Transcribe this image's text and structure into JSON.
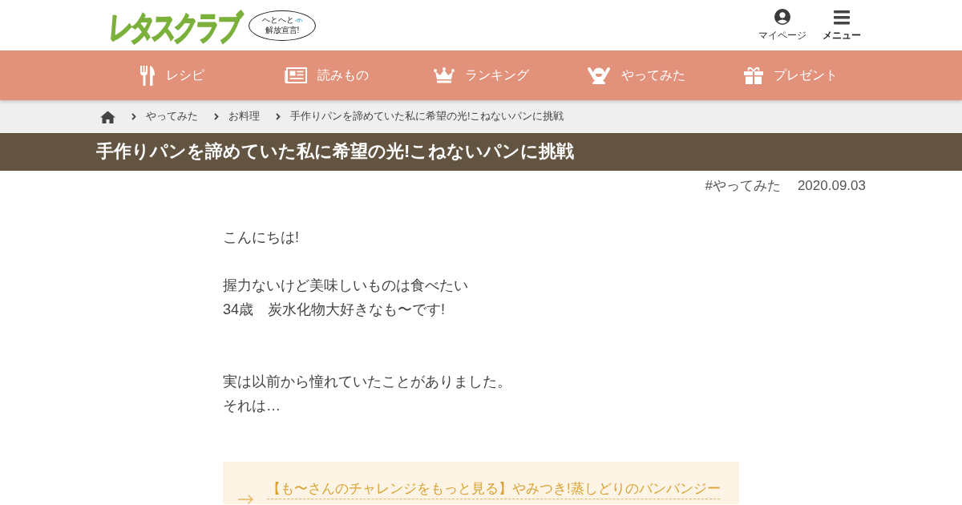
{
  "header": {
    "logo": "レタスクラブ",
    "tagline": [
      "へとへと",
      "解放宣言!"
    ],
    "actions": [
      {
        "kind": "account",
        "label": "マイページ"
      },
      {
        "kind": "menu",
        "label": "メニュー"
      }
    ]
  },
  "nav": [
    {
      "kind": "recipe",
      "label": "レシピ"
    },
    {
      "kind": "reading",
      "label": "読みもの"
    },
    {
      "kind": "ranking",
      "label": "ランキング"
    },
    {
      "kind": "tried",
      "label": "やってみた"
    },
    {
      "kind": "present",
      "label": "プレゼント"
    }
  ],
  "breadcrumb": [
    "やってみた",
    "お料理",
    "手作りパンを諦めていた私に希望の光!こねないパンに挑戦"
  ],
  "article": {
    "title": "手作りパンを諦めていた私に希望の光!こねないパンに挑戦",
    "tag": "#やってみた",
    "date": "2020.09.03",
    "paragraphs": [
      {
        "lines": [
          "こんにちは!"
        ]
      },
      {
        "lines": [
          "握力ないけど美味しいものは食べたい",
          "34歳　炭水化物大好きなも〜です!"
        ]
      },
      {
        "lines": [
          "実は以前から憧れていたことがありました。",
          "それは…"
        ]
      }
    ],
    "related_link": "【も〜さんのチャレンジをもっと見る】やみつき!蒸しどりのバンバンジー"
  }
}
